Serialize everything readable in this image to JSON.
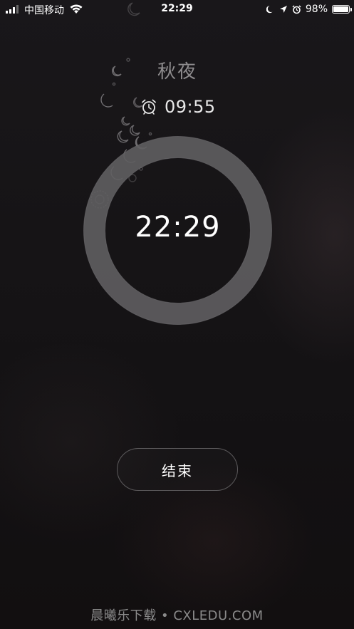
{
  "status_bar": {
    "carrier": "中国移动",
    "time": "22:29",
    "battery_percent": "98%",
    "battery_level": 0.98,
    "icons": [
      "signal-icon",
      "wifi-icon",
      "moon-icon",
      "location-arrow-icon",
      "alarm-icon",
      "battery-icon"
    ]
  },
  "alarm": {
    "label": "秋夜",
    "set_time": "09:55",
    "current_time": "22:29",
    "end_label": "结束"
  },
  "colors": {
    "background": "#141214",
    "ring": "#5f5e60",
    "text_primary": "#ffffff",
    "text_muted": "#8e8c8e"
  },
  "watermark": "晨曦乐下载 • CXLEDU.COM"
}
